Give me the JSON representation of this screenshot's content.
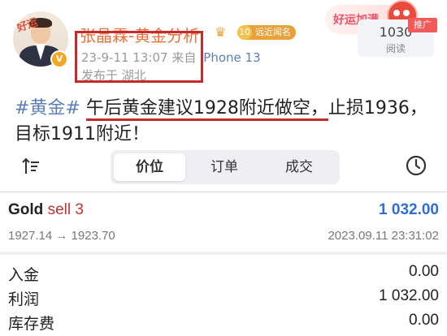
{
  "post": {
    "avatar_tag": "好运",
    "author": "张晶霖-黄金分析",
    "level": "10",
    "level_label": "远近闻名",
    "timestamp": "23-9-11 13:07",
    "source_prefix": "来自",
    "device": "iPhone 13",
    "location": "发布于 湖北",
    "promo_text": "好运加满",
    "promote_label": "推广",
    "read_count": "1030",
    "read_label": "阅读",
    "hashtag": "#黄金#",
    "text_highlight": "午后黄金建议1928附近做空，",
    "text_rest": "止损1936，目标1911附近！"
  },
  "app": {
    "tabs": [
      {
        "label": "价位",
        "active": true
      },
      {
        "label": "订单",
        "active": false
      },
      {
        "label": "成交",
        "active": false
      }
    ],
    "trade": {
      "symbol": "Gold",
      "side": "sell 3",
      "profit": "1 032.00",
      "prices": "1927.14 → 1923.70",
      "datetime": "2023.09.11 23:31:02"
    },
    "summary": [
      {
        "label": "入金",
        "value": "0.00"
      },
      {
        "label": "利润",
        "value": "1 032.00"
      },
      {
        "label": "库存费",
        "value": "0.00"
      }
    ]
  },
  "colors": {
    "author": "#e8703a",
    "link": "#5b7fb6",
    "annotation_red": "#c62a2a",
    "sell_red": "#c2332e",
    "profit_blue": "#2f6fd1"
  },
  "icons": [
    "crown-icon",
    "verified-icon",
    "sort-icon",
    "clock-icon",
    "mascot-icon"
  ]
}
